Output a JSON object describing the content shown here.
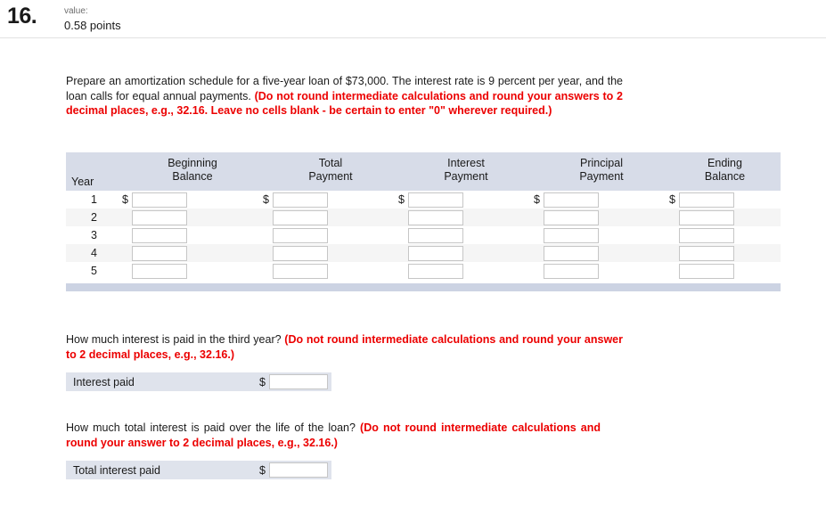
{
  "header": {
    "question_number": "16.",
    "value_label": "value:",
    "points": "0.58 points"
  },
  "main_prompt": {
    "plain": "Prepare an amortization schedule for a five-year loan of $73,000. The interest rate is 9 percent per year, and the loan calls for equal annual payments. ",
    "emphasis": "(Do not round intermediate calculations and round your answers to 2 decimal places, e.g., 32.16. Leave no cells blank - be certain to enter \"0\" wherever required.)"
  },
  "table": {
    "columns": [
      {
        "line1": "Year",
        "line2": ""
      },
      {
        "line1": "Beginning",
        "line2": "Balance"
      },
      {
        "line1": "Total",
        "line2": "Payment"
      },
      {
        "line1": "Interest",
        "line2": "Payment"
      },
      {
        "line1": "Principal",
        "line2": "Payment"
      },
      {
        "line1": "Ending",
        "line2": "Balance"
      }
    ],
    "currency_symbol": "$",
    "rows": [
      {
        "year": "1",
        "show_dollar": true,
        "values": [
          "",
          "",
          "",
          "",
          ""
        ]
      },
      {
        "year": "2",
        "show_dollar": false,
        "values": [
          "",
          "",
          "",
          "",
          ""
        ]
      },
      {
        "year": "3",
        "show_dollar": false,
        "values": [
          "",
          "",
          "",
          "",
          ""
        ]
      },
      {
        "year": "4",
        "show_dollar": false,
        "values": [
          "",
          "",
          "",
          "",
          ""
        ]
      },
      {
        "year": "5",
        "show_dollar": false,
        "values": [
          "",
          "",
          "",
          "",
          ""
        ]
      }
    ]
  },
  "question_two": {
    "plain": "How much interest is paid in the third year? ",
    "emphasis": "(Do not round intermediate calculations and round your answer to 2 decimal places, e.g., 32.16.)",
    "answer_label": "Interest paid",
    "currency_symbol": "$",
    "answer_value": ""
  },
  "question_three": {
    "plain": "How much total interest is paid over the life of the loan? ",
    "emphasis": "(Do not round intermediate calculations and round your answer to 2 decimal places, e.g., 32.16.)",
    "answer_label": "Total interest paid",
    "currency_symbol": "$",
    "answer_value": ""
  },
  "colors": {
    "header_fill": "#d7dce8",
    "alt_row": "#f5f5f5",
    "answer_fill": "#dfe3ec",
    "footer_bar": "#ccd3e3",
    "emphasis_text": "#ec0000"
  }
}
